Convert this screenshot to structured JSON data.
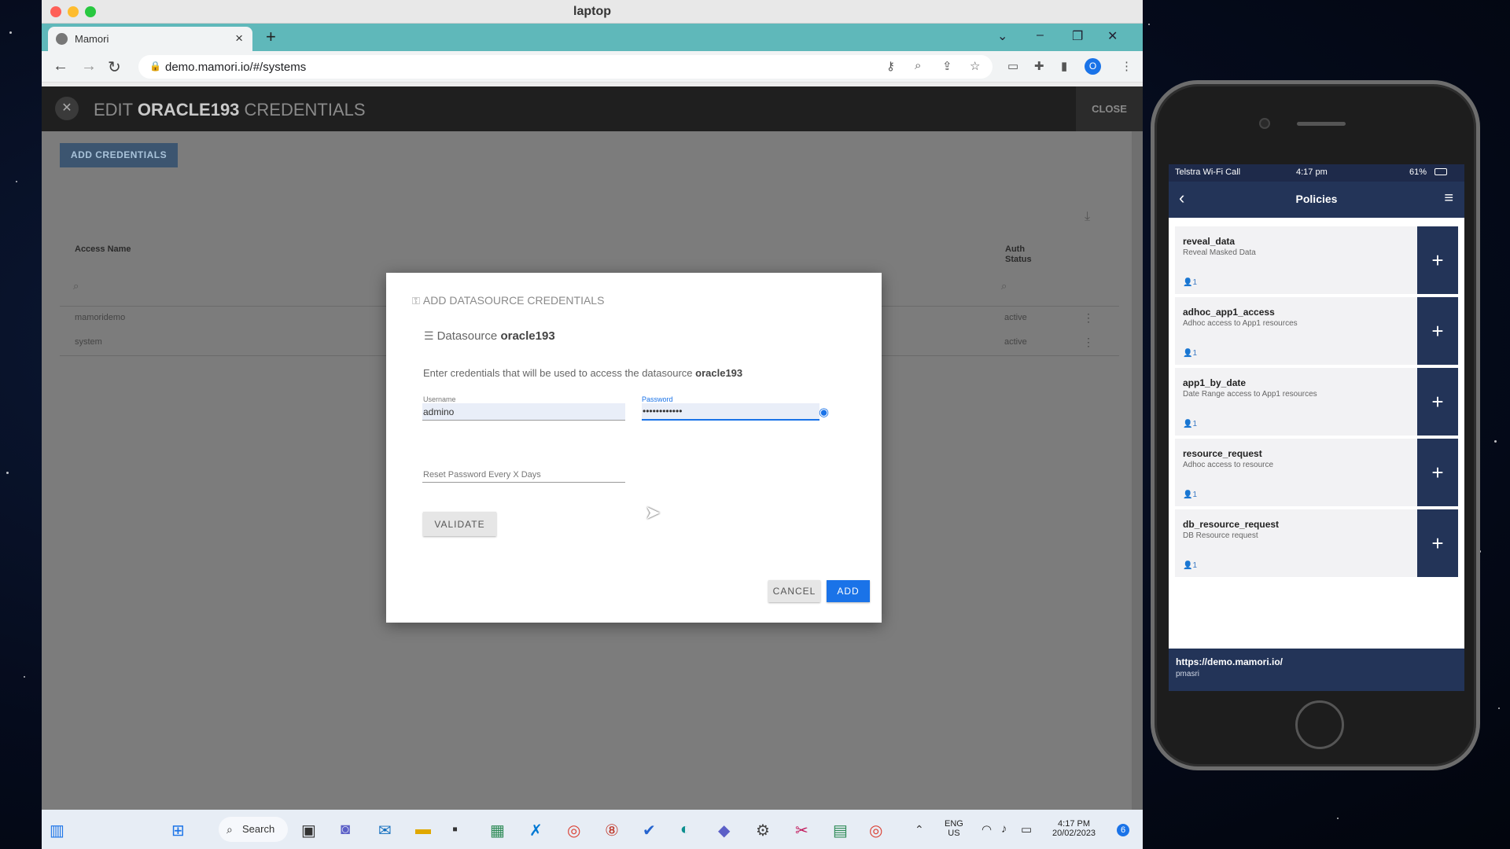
{
  "mac": {
    "window_title": "laptop"
  },
  "browser": {
    "tab_title": "Mamori",
    "url": "demo.mamori.io/#/systems",
    "profile_initial": "O"
  },
  "app": {
    "header_prefix": "EDIT ",
    "header_system": "ORACLE193",
    "header_suffix": " CREDENTIALS",
    "close_label": "CLOSE",
    "add_credentials_label": "ADD CREDENTIALS",
    "table": {
      "col_access_name": "Access Name",
      "col_auth_status_1": "Auth",
      "col_auth_status_2": "Status",
      "rows": [
        {
          "name": "mamoridemo",
          "status": "active"
        },
        {
          "name": "system",
          "status": "active"
        }
      ]
    }
  },
  "modal": {
    "title": "ADD DATASOURCE CREDENTIALS",
    "datasource_label": "Datasource",
    "datasource_name": "oracle193",
    "description_prefix": "Enter credentials that will be used to access the datasource ",
    "description_name": "oracle193",
    "username_label": "Username",
    "username_value": "admino",
    "password_label": "Password",
    "password_value": "••••••••••••",
    "reset_placeholder": "Reset Password Every X Days",
    "validate_label": "VALIDATE",
    "cancel_label": "CANCEL",
    "add_label": "ADD"
  },
  "taskbar": {
    "search_label": "Search",
    "lang_1": "ENG",
    "lang_2": "US",
    "time": "4:17 PM",
    "date": "20/02/2023",
    "notification_count": "6"
  },
  "phone": {
    "carrier": "Telstra Wi-Fi Call",
    "time": "4:17 pm",
    "battery": "61%",
    "nav_title": "Policies",
    "policies": [
      {
        "name": "reveal_data",
        "desc": "Reveal Masked Data",
        "count": "1"
      },
      {
        "name": "adhoc_app1_access",
        "desc": "Adhoc access to App1 resources",
        "count": "1"
      },
      {
        "name": "app1_by_date",
        "desc": "Date Range access to App1 resources",
        "count": "1"
      },
      {
        "name": "resource_request",
        "desc": "Adhoc access to resource",
        "count": "1"
      },
      {
        "name": "db_resource_request",
        "desc": "DB Resource request",
        "count": "1"
      }
    ],
    "footer_url": "https://demo.mamori.io/",
    "footer_user": "pmasri"
  },
  "colors": {
    "tab_strip": "#5fb8ba",
    "primary_blue": "#1a73e8",
    "phone_navy": "#233458"
  },
  "icons": [
    "close-icon",
    "lock-icon",
    "eye-icon",
    "datasource-icon",
    "search-icon",
    "download-icon",
    "kebab-icon",
    "plus-icon",
    "user-icon",
    "hamburger-icon",
    "back-arrow-icon"
  ]
}
